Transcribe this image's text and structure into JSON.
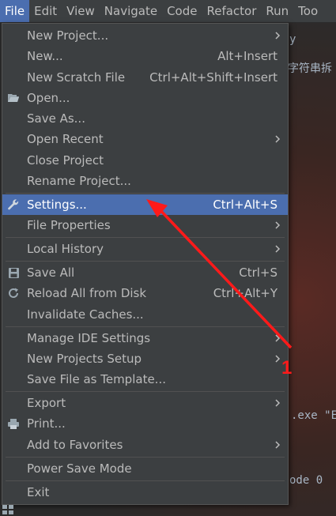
{
  "menubar": {
    "items": [
      "File",
      "Edit",
      "View",
      "Navigate",
      "Code",
      "Refactor",
      "Run",
      "Too"
    ]
  },
  "background_text": {
    "right1": "y",
    "right2": "字符串拆",
    "right3": ".exe \"E",
    "right4": "ode 0"
  },
  "file_menu": {
    "new_project": "New Project...",
    "new": "New...",
    "new_shortcut": "Alt+Insert",
    "new_scratch": "New Scratch File",
    "new_scratch_shortcut": "Ctrl+Alt+Shift+Insert",
    "open": "Open...",
    "save_as": "Save As...",
    "open_recent": "Open Recent",
    "close_project": "Close Project",
    "rename_project": "Rename Project...",
    "settings": "Settings...",
    "settings_shortcut": "Ctrl+Alt+S",
    "file_properties": "File Properties",
    "local_history": "Local History",
    "save_all": "Save All",
    "save_all_shortcut": "Ctrl+S",
    "reload_all": "Reload All from Disk",
    "reload_all_shortcut": "Ctrl+Alt+Y",
    "invalidate_caches": "Invalidate Caches...",
    "manage_ide_settings": "Manage IDE Settings",
    "new_projects_setup": "New Projects Setup",
    "save_as_template": "Save File as Template...",
    "export": "Export",
    "print": "Print...",
    "add_to_favorites": "Add to Favorites",
    "power_save_mode": "Power Save Mode",
    "exit": "Exit"
  },
  "annotation": {
    "number": "1",
    "color": "#ff1a1a"
  },
  "colors": {
    "menu_bg": "#3c3f41",
    "selection": "#4b6eaf",
    "text": "#bbbbbb"
  }
}
